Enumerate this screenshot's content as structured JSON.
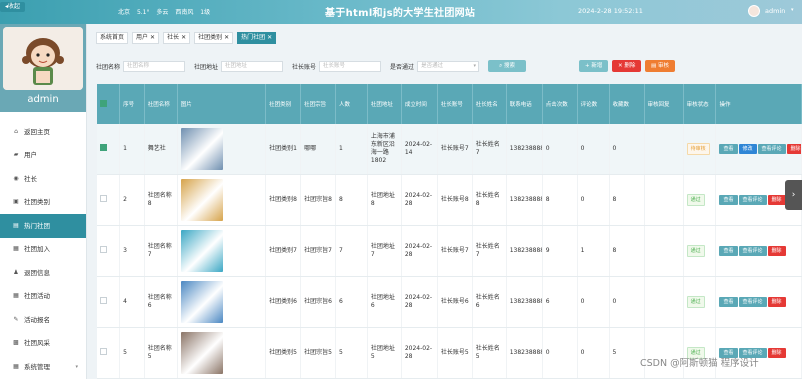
{
  "topbar": {
    "collapse": "收起",
    "weather": [
      "北京",
      "5.1°",
      "多云",
      "西南风",
      "1级"
    ],
    "title": "基于html和js的大学生社团网站",
    "datetime": "2024-2-28 19:52:11",
    "username": "admin"
  },
  "sidebar": {
    "profile_name": "admin",
    "items": [
      {
        "label": "返回主页",
        "icon": "home-icon"
      },
      {
        "label": "用户",
        "icon": "user-icon"
      },
      {
        "label": "社长",
        "icon": "person-icon"
      },
      {
        "label": "社团类别",
        "icon": "category-icon"
      },
      {
        "label": "热门社团",
        "icon": "list-icon",
        "active": true
      },
      {
        "label": "社团加入",
        "icon": "join-icon"
      },
      {
        "label": "退团信息",
        "icon": "exit-icon"
      },
      {
        "label": "社团活动",
        "icon": "activity-icon"
      },
      {
        "label": "活动报名",
        "icon": "signup-icon"
      },
      {
        "label": "社团风采",
        "icon": "style-icon"
      },
      {
        "label": "系统管理",
        "icon": "settings-icon",
        "has_arrow": true
      }
    ]
  },
  "tabs": [
    {
      "label": "系统首页",
      "closable": false
    },
    {
      "label": "用户",
      "closable": true
    },
    {
      "label": "社长",
      "closable": true
    },
    {
      "label": "社团类别",
      "closable": true
    },
    {
      "label": "热门社团",
      "closable": true,
      "active": true
    }
  ],
  "search": {
    "club_name_label": "社团名称",
    "club_name_placeholder": "社团名称",
    "club_addr_label": "社团地址",
    "club_addr_placeholder": "社团地址",
    "leader_no_label": "社长账号",
    "leader_no_placeholder": "社长账号",
    "approved_label": "是否通过",
    "approved_placeholder": "是否通过",
    "search_btn": "搜索"
  },
  "actions": {
    "add": "新增",
    "delete": "删除",
    "audit": "审核"
  },
  "table": {
    "headers": [
      "序号",
      "社团名称",
      "图片",
      "社团类别",
      "社团宗旨",
      "人数",
      "社团地址",
      "成立时间",
      "社长账号",
      "社长姓名",
      "联系电话",
      "点击次数",
      "评论数",
      "收藏数",
      "审核回复",
      "审核状态",
      "操作"
    ],
    "rows": [
      {
        "idx": "1",
        "name": "舞艺社",
        "category": "社团类别1",
        "purpose": "哪哪",
        "members": "1",
        "address": "上海市浦东新区沿海一路1802",
        "founded": "2024-02-14",
        "leader_no": "社长账号7",
        "leader_name": "社长姓名7",
        "phone": "13823888887",
        "clicks": "0",
        "comments": "0",
        "favorites": "0",
        "reply": "",
        "status": "待审核",
        "status_type": "pending",
        "ops": [
          "查看",
          "修改",
          "查看评论",
          "删除"
        ],
        "selected": true,
        "thumb": "#6f8fb0"
      },
      {
        "idx": "2",
        "name": "社团名称8",
        "category": "社团类别8",
        "purpose": "社团宗旨8",
        "members": "8",
        "address": "社团地址8",
        "founded": "2024-02-28",
        "leader_no": "社长账号8",
        "leader_name": "社长姓名8",
        "phone": "13823888888",
        "clicks": "8",
        "comments": "0",
        "favorites": "8",
        "reply": "",
        "status": "通过",
        "status_type": "pass",
        "ops": [
          "查看",
          "查看评论",
          "删除"
        ],
        "selected": false,
        "thumb": "#d6a34a"
      },
      {
        "idx": "3",
        "name": "社团名称7",
        "category": "社团类别7",
        "purpose": "社团宗旨7",
        "members": "7",
        "address": "社团地址7",
        "founded": "2024-02-28",
        "leader_no": "社长账号7",
        "leader_name": "社长姓名7",
        "phone": "13823888887",
        "clicks": "9",
        "comments": "1",
        "favorites": "8",
        "reply": "",
        "status": "通过",
        "status_type": "pass",
        "ops": [
          "查看",
          "查看评论",
          "删除"
        ],
        "selected": false,
        "thumb": "#3aa7c4"
      },
      {
        "idx": "4",
        "name": "社团名称6",
        "category": "社团类别6",
        "purpose": "社团宗旨6",
        "members": "6",
        "address": "社团地址6",
        "founded": "2024-02-28",
        "leader_no": "社长账号6",
        "leader_name": "社长姓名6",
        "phone": "13823888886",
        "clicks": "6",
        "comments": "0",
        "favorites": "0",
        "reply": "",
        "status": "通过",
        "status_type": "pass",
        "ops": [
          "查看",
          "查看评论",
          "删除"
        ],
        "selected": false,
        "thumb": "#4a87c2"
      },
      {
        "idx": "5",
        "name": "社团名称5",
        "category": "社团类别5",
        "purpose": "社团宗旨5",
        "members": "5",
        "address": "社团地址5",
        "founded": "2024-02-28",
        "leader_no": "社长账号5",
        "leader_name": "社长姓名5",
        "phone": "13823888885",
        "clicks": "0",
        "comments": "0",
        "favorites": "5",
        "reply": "",
        "status": "通过",
        "status_type": "pass",
        "ops": [
          "查看",
          "查看评论",
          "删除"
        ],
        "selected": false,
        "thumb": "#8a7466"
      }
    ]
  },
  "watermark": "CSDN @阿斯顿猫 程序设计",
  "colors": {
    "primary": "#2f8fa0",
    "header_bg": "#5aa8b6",
    "danger": "#e53935",
    "warning": "#ef7d32"
  }
}
